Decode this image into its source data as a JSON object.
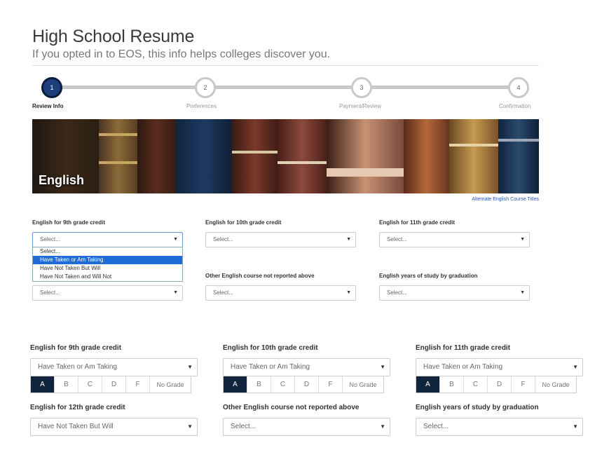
{
  "header": {
    "title": "High School Resume",
    "subtitle": "If you opted in to EOS, this info helps colleges discover you."
  },
  "stepper": [
    {
      "num": "1",
      "label": "Review Info",
      "active": true
    },
    {
      "num": "2",
      "label": "Preferences",
      "active": false
    },
    {
      "num": "3",
      "label": "Payment/Review",
      "active": false
    },
    {
      "num": "4",
      "label": "Confirmation",
      "active": false
    }
  ],
  "banner": {
    "title": "English"
  },
  "alt_link": "Alternate English Course Titles",
  "form_top": {
    "row1": [
      {
        "label": "English for 9th grade credit",
        "value": "Select..."
      },
      {
        "label": "English for 10th grade credit",
        "value": "Select..."
      },
      {
        "label": "English for 11th grade credit",
        "value": "Select..."
      }
    ],
    "dropdown_options": [
      "Select...",
      "Have Taken or Am Taking",
      "Have Not Taken But Will",
      "Have Not Taken and Will Not"
    ],
    "row2": [
      {
        "label": "",
        "value": "Select..."
      },
      {
        "label": "Other English course not reported above",
        "value": "Select..."
      },
      {
        "label": "English years of study by graduation",
        "value": "Select..."
      }
    ]
  },
  "form_bottom": {
    "row1": [
      {
        "label": "English for 9th grade credit",
        "value": "Have Taken or Am Taking"
      },
      {
        "label": "English for 10th grade credit",
        "value": "Have Taken or Am Taking"
      },
      {
        "label": "English for 11th grade credit",
        "value": "Have Taken or Am Taking"
      }
    ],
    "grades": [
      "A",
      "B",
      "C",
      "D",
      "F",
      "No Grade"
    ],
    "selected_grade": "A",
    "row2": [
      {
        "label": "English for 12th grade credit",
        "value": "Have Not Taken But Will"
      },
      {
        "label": "Other English course not reported above",
        "value": "Select..."
      },
      {
        "label": "English years of study by graduation",
        "value": "Select..."
      }
    ]
  },
  "caret_glyph": "▼",
  "colors": {
    "accent": "#1c3f7c",
    "selected_grade_bg": "#10243d",
    "highlight": "#1f6bd6"
  }
}
